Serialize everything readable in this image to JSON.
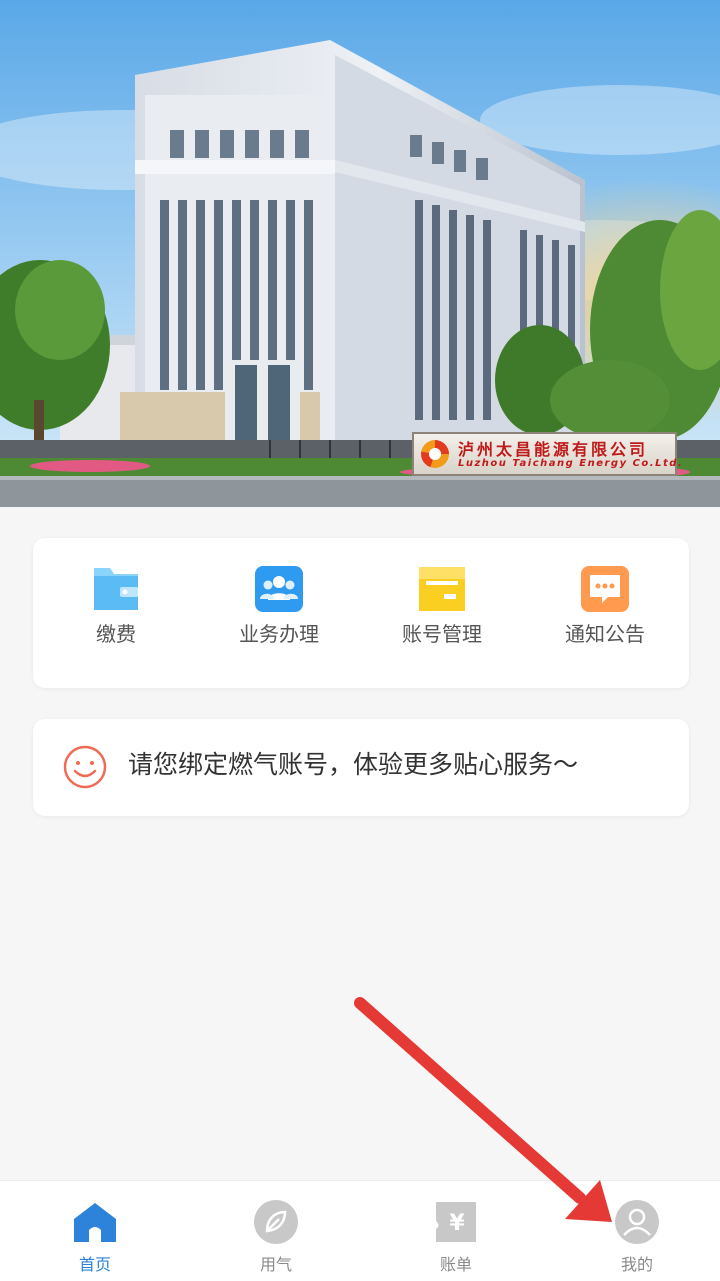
{
  "banner": {
    "company_name_cn": "泸州太昌能源有限公司",
    "company_name_en": "Luzhou Taichang Energy Co.Ltd."
  },
  "menu": {
    "items": [
      {
        "label": "缴费",
        "icon": "folder-pay-icon",
        "color": "#5bbcf5"
      },
      {
        "label": "业务办理",
        "icon": "people-icon",
        "color": "#2f9bf0"
      },
      {
        "label": "账号管理",
        "icon": "account-card-icon",
        "color": "#fbcf22"
      },
      {
        "label": "通知公告",
        "icon": "message-icon",
        "color": "#ff9a4f"
      }
    ]
  },
  "bind_notice": {
    "text": "请您绑定燃气账号，体验更多贴心服务～",
    "icon": "smile-icon",
    "icon_color": "#ef6b55"
  },
  "tabbar": {
    "tabs": [
      {
        "label": "首页",
        "icon": "home-icon",
        "active": true
      },
      {
        "label": "用气",
        "icon": "leaf-icon",
        "active": false
      },
      {
        "label": "账单",
        "icon": "bill-icon",
        "active": false
      },
      {
        "label": "我的",
        "icon": "user-icon",
        "active": false
      }
    ],
    "active_color": "#2c83d9",
    "inactive_color": "#c8c8c8"
  },
  "annotation": {
    "color": "#e53935"
  }
}
